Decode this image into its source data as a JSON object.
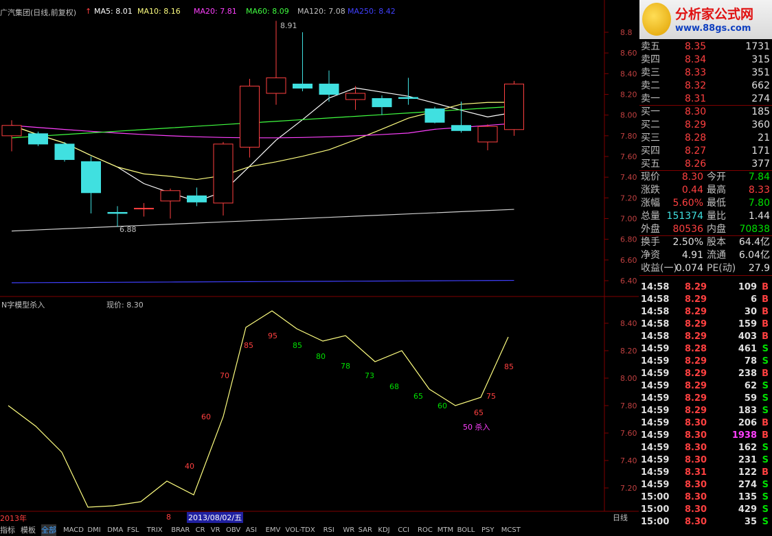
{
  "header": {
    "stock": "广汽集团(日线,前复权)",
    "ma5": "MA5: 8.01",
    "ma10": "MA10: 8.16",
    "ma20": "MA20: 7.81",
    "ma60": "MA60: 8.09",
    "ma120": "MA120: 7.08",
    "ma250": "MA250: 8.42",
    "high_mark": "8.91",
    "low_mark": "6.88"
  },
  "sub_header": {
    "title": "N字模型杀入",
    "price": "现价: 8.30"
  },
  "price_axis": [
    "8.8",
    "8.60",
    "8.40",
    "8.20",
    "8.00",
    "7.80",
    "7.60",
    "7.40",
    "7.20",
    "7.00",
    "6.80",
    "6.60",
    "6.40"
  ],
  "sub_axis": [
    "8.40",
    "8.20",
    "8.00",
    "7.80",
    "7.60",
    "7.40",
    "7.20"
  ],
  "chart_data": {
    "type": "candlestick",
    "candles": [
      {
        "o": 7.8,
        "c": 7.9,
        "h": 7.95,
        "l": 7.65
      },
      {
        "o": 7.82,
        "c": 7.72,
        "h": 7.84,
        "l": 7.7
      },
      {
        "o": 7.72,
        "c": 7.57,
        "h": 7.74,
        "l": 7.55
      },
      {
        "o": 7.55,
        "c": 7.25,
        "h": 7.6,
        "l": 7.05
      },
      {
        "o": 7.06,
        "c": 7.05,
        "h": 7.12,
        "l": 6.92
      },
      {
        "o": 7.1,
        "c": 7.1,
        "h": 7.15,
        "l": 7.02
      },
      {
        "o": 7.17,
        "c": 7.27,
        "h": 7.29,
        "l": 7.0
      },
      {
        "o": 7.22,
        "c": 7.16,
        "h": 7.3,
        "l": 7.12
      },
      {
        "o": 7.15,
        "c": 7.72,
        "h": 7.74,
        "l": 7.03
      },
      {
        "o": 7.69,
        "c": 8.28,
        "h": 8.35,
        "l": 7.59
      },
      {
        "o": 8.21,
        "c": 8.36,
        "h": 8.91,
        "l": 8.1
      },
      {
        "o": 8.3,
        "c": 8.26,
        "h": 8.8,
        "l": 8.23
      },
      {
        "o": 8.3,
        "c": 8.2,
        "h": 8.43,
        "l": 8.13
      },
      {
        "o": 8.15,
        "c": 8.21,
        "h": 8.28,
        "l": 8.05
      },
      {
        "o": 8.16,
        "c": 8.08,
        "h": 8.19,
        "l": 8.0
      },
      {
        "o": 8.17,
        "c": 8.16,
        "h": 8.36,
        "l": 8.1
      },
      {
        "o": 8.06,
        "c": 7.93,
        "h": 8.08,
        "l": 7.92
      },
      {
        "o": 7.9,
        "c": 7.85,
        "h": 8.13,
        "l": 7.83
      },
      {
        "o": 7.74,
        "c": 7.89,
        "h": 7.91,
        "l": 7.66
      },
      {
        "o": 7.86,
        "c": 8.3,
        "h": 8.33,
        "l": 7.8
      }
    ],
    "sub_line": [
      7.8,
      7.65,
      7.46,
      7.06,
      7.07,
      7.1,
      7.25,
      7.15,
      7.72,
      8.37,
      8.49,
      8.36,
      8.27,
      8.31,
      8.12,
      8.2,
      7.92,
      7.8,
      7.86,
      8.3
    ],
    "sub_labels": [
      "",
      "",
      "",
      "",
      "",
      "",
      "",
      "40",
      "60",
      "70",
      "85",
      "95",
      "85",
      "80",
      "78",
      "73",
      "68",
      "65",
      "60",
      "65",
      "75",
      "85"
    ],
    "signal_text": "50 杀入"
  },
  "quote": {
    "asks": [
      [
        "卖五",
        "8.35",
        "1731"
      ],
      [
        "卖四",
        "8.34",
        "315"
      ],
      [
        "卖三",
        "8.33",
        "351"
      ],
      [
        "卖二",
        "8.32",
        "662"
      ],
      [
        "卖一",
        "8.31",
        "274"
      ]
    ],
    "bids": [
      [
        "买一",
        "8.30",
        "185"
      ],
      [
        "买二",
        "8.29",
        "360"
      ],
      [
        "买三",
        "8.28",
        "21"
      ],
      [
        "买四",
        "8.27",
        "171"
      ],
      [
        "买五",
        "8.26",
        "377"
      ]
    ],
    "stats": [
      [
        "现价",
        "8.30",
        "今开",
        "7.84"
      ],
      [
        "涨跌",
        "0.44",
        "最高",
        "8.33"
      ],
      [
        "涨幅",
        "5.60%",
        "最低",
        "7.80"
      ],
      [
        "总量",
        "151374",
        "量比",
        "1.44"
      ],
      [
        "外盘",
        "80536",
        "内盘",
        "70838"
      ]
    ],
    "stats2": [
      [
        "换手",
        "2.50%",
        "股本",
        "64.4亿"
      ],
      [
        "净资",
        "4.91",
        "流通",
        "6.04亿"
      ],
      [
        "收益(一)",
        "0.074",
        "PE(动)",
        "27.9"
      ]
    ]
  },
  "ticks": [
    [
      "14:58",
      "8.29",
      "109",
      "B"
    ],
    [
      "14:58",
      "8.29",
      "6",
      "B"
    ],
    [
      "14:58",
      "8.29",
      "30",
      "B"
    ],
    [
      "14:58",
      "8.29",
      "159",
      "B"
    ],
    [
      "14:58",
      "8.29",
      "403",
      "B"
    ],
    [
      "14:59",
      "8.28",
      "461",
      "S"
    ],
    [
      "14:59",
      "8.29",
      "78",
      "S"
    ],
    [
      "14:59",
      "8.29",
      "238",
      "B"
    ],
    [
      "14:59",
      "8.29",
      "62",
      "S"
    ],
    [
      "14:59",
      "8.29",
      "59",
      "S"
    ],
    [
      "14:59",
      "8.29",
      "183",
      "S"
    ],
    [
      "14:59",
      "8.30",
      "206",
      "B"
    ],
    [
      "14:59",
      "8.30",
      "1938",
      "B"
    ],
    [
      "14:59",
      "8.30",
      "162",
      "S"
    ],
    [
      "14:59",
      "8.30",
      "231",
      "S"
    ],
    [
      "14:59",
      "8.31",
      "122",
      "B"
    ],
    [
      "14:59",
      "8.30",
      "274",
      "S"
    ],
    [
      "15:00",
      "8.30",
      "135",
      "S"
    ],
    [
      "15:00",
      "8.30",
      "429",
      "S"
    ],
    [
      "15:00",
      "8.30",
      "35",
      "S"
    ]
  ],
  "footer": {
    "year": "2013年",
    "mark": "8",
    "date": "2013/08/02/五",
    "period": "日线",
    "tabs": [
      "指标",
      "模板",
      "全部"
    ],
    "indicators": [
      "MACD",
      "DMI",
      "DMA",
      "FSL",
      "TRIX",
      "BRAR",
      "CR",
      "VR",
      "OBV",
      "ASI",
      "EMV",
      "VOL-TDX",
      "RSI",
      "WR",
      "SAR",
      "KDJ",
      "CCI",
      "ROC",
      "MTM",
      "BOLL",
      "PSY",
      "MCST"
    ]
  },
  "logo": {
    "name": "分析家公式网",
    "url": "www.88gs.com"
  },
  "colors": {
    "up": "#ff4040",
    "down": "#40e0e0",
    "ma5": "#ffffff",
    "ma10": "#ffff80",
    "ma20": "#ff40ff",
    "ma60": "#40ff40",
    "ma250": "#4040ff"
  }
}
